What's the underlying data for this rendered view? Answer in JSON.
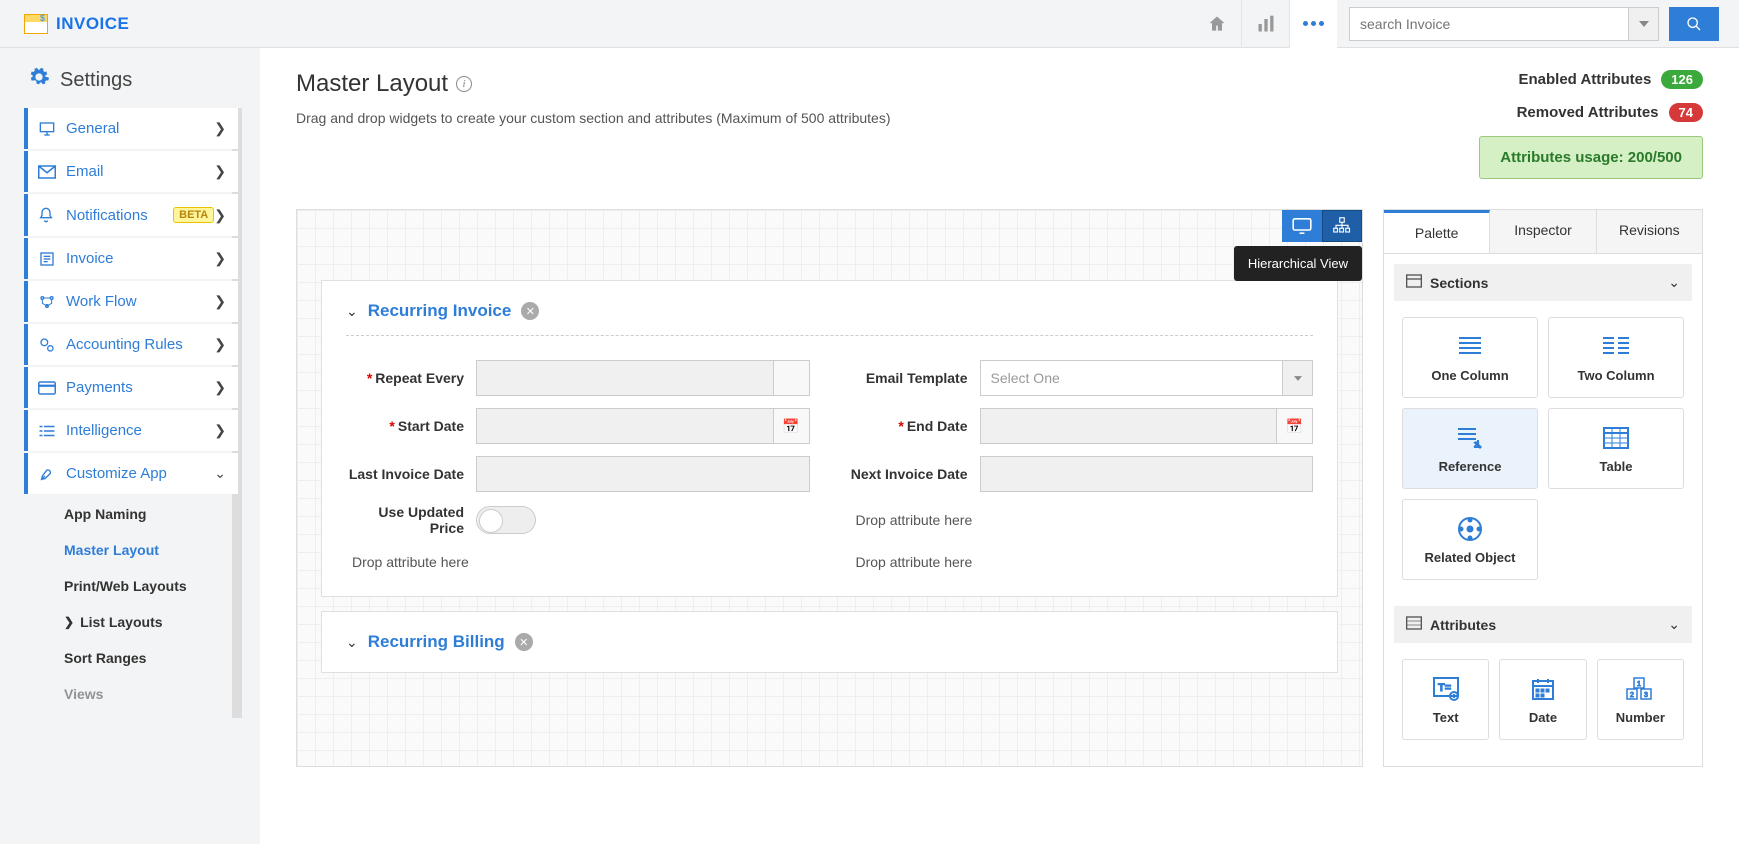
{
  "app": {
    "name": "INVOICE",
    "search_placeholder": "search Invoice"
  },
  "sidebar": {
    "title": "Settings",
    "items": [
      {
        "label": "General"
      },
      {
        "label": "Email"
      },
      {
        "label": "Notifications",
        "badge": "BETA"
      },
      {
        "label": "Invoice"
      },
      {
        "label": "Work Flow"
      },
      {
        "label": "Accounting Rules"
      },
      {
        "label": "Payments"
      },
      {
        "label": "Intelligence"
      },
      {
        "label": "Customize App"
      }
    ],
    "subitems": [
      {
        "label": "App Naming"
      },
      {
        "label": "Master Layout",
        "active": true
      },
      {
        "label": "Print/Web Layouts"
      },
      {
        "label": "List Layouts",
        "chev": true
      },
      {
        "label": "Sort Ranges"
      },
      {
        "label": "Views"
      }
    ]
  },
  "page": {
    "title": "Master Layout",
    "subtitle": "Drag and drop widgets to create your custom section and attributes (Maximum of 500 attributes)",
    "enabled_label": "Enabled Attributes",
    "enabled_count": "126",
    "removed_label": "Removed Attributes",
    "removed_count": "74",
    "usage_label": "Attributes usage: 200/500"
  },
  "tooltip": "Hierarchical View",
  "sections": [
    {
      "title": "Recurring Invoice",
      "fields": {
        "repeat_every": "Repeat Every",
        "email_template": "Email Template",
        "email_template_placeholder": "Select One",
        "start_date": "Start Date",
        "end_date": "End Date",
        "last_invoice": "Last Invoice Date",
        "next_invoice": "Next Invoice Date",
        "use_updated": "Use Updated Price",
        "drop_hint": "Drop attribute here"
      }
    },
    {
      "title": "Recurring Billing"
    }
  ],
  "panel": {
    "tabs": [
      "Palette",
      "Inspector",
      "Revisions"
    ],
    "sections_head": "Sections",
    "attributes_head": "Attributes",
    "section_widgets": [
      "One Column",
      "Two Column",
      "Reference",
      "Table",
      "Related Object"
    ],
    "attr_widgets": [
      "Text",
      "Date",
      "Number"
    ]
  }
}
